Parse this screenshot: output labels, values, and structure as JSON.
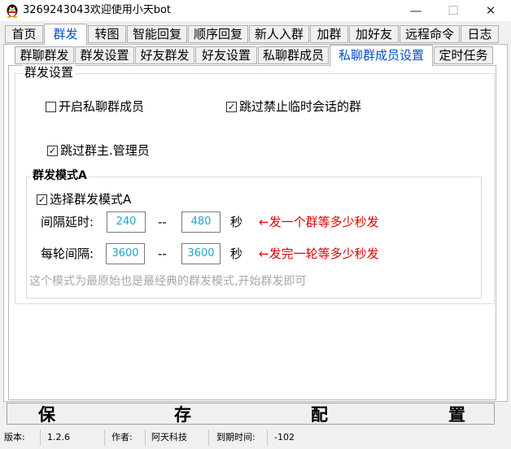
{
  "window": {
    "title": "3269243043欢迎使用小天bot",
    "icon": "penguin-icon",
    "controls": {
      "minimize": "—",
      "maximize": "☐",
      "close": "✕"
    }
  },
  "main_tabs": [
    "首页",
    "群发",
    "转图",
    "智能回复",
    "顺序回复",
    "新人入群",
    "加群",
    "加好友",
    "远程命令",
    "日志"
  ],
  "main_tab_selected": "群发",
  "sub_tabs": [
    "群聊群发",
    "群发设置",
    "好友群发",
    "好友设置",
    "私聊群成员",
    "私聊群成员设置",
    "定时任务"
  ],
  "sub_tab_selected": "私聊群成员设置",
  "settings": {
    "group_title": "群发设置",
    "enable_private_members": {
      "label": "开启私聊群成员",
      "checked": false
    },
    "skip_no_temp_chat": {
      "label": "跳过禁止临时会话的群",
      "checked": true
    },
    "skip_owner_admin": {
      "label": "跳过群主.管理员",
      "checked": true
    }
  },
  "mode_a": {
    "title": "群发模式A",
    "select_mode": {
      "label": "选择群发模式A",
      "checked": true
    },
    "interval_label": "间隔延时:",
    "interval_min": "240",
    "interval_max": "480",
    "round_label": "每轮间隔:",
    "round_min": "3600",
    "round_max": "3600",
    "dash": "--",
    "unit": "秒",
    "note_interval": "←发一个群等多少秒发",
    "note_round": "←发完一轮等多少秒发",
    "hint": "这个模式为最原始也是最经典的群发模式,开始群发即可"
  },
  "save_button": {
    "chars": [
      "保",
      "存",
      "配",
      "置"
    ]
  },
  "status_bar": {
    "version_label": "版本:",
    "version": "1.2.6",
    "author_label": "作者:",
    "author": "阿天科技",
    "expiry_label": "到期时间:",
    "expiry": "-102"
  },
  "colors": {
    "accent": "#0050c8",
    "note_red": "#e00000",
    "input_text": "#22a5c8",
    "hint_gray": "#a8a8a8"
  }
}
